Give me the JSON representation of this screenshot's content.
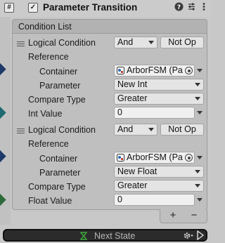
{
  "header": {
    "script_icon": "#",
    "enabled_check": "✓",
    "title": "Parameter Transition",
    "icons": [
      "help-icon",
      "preset-icon",
      "more-icon"
    ]
  },
  "list": {
    "title": "Condition List",
    "conditions": [
      {
        "logical_label": "Logical Condition",
        "logical_value": "And",
        "not_label": "Not Op",
        "reference_label": "Reference",
        "container_label": "Container",
        "container_value": "ArborFSM (Pa",
        "parameter_label": "Parameter",
        "parameter_value": "New Int",
        "compare_label": "Compare Type",
        "compare_value": "Greater",
        "value_label": "Int Value",
        "value": "0"
      },
      {
        "logical_label": "Logical Condition",
        "logical_value": "And",
        "not_label": "Not Op",
        "reference_label": "Reference",
        "container_label": "Container",
        "container_value": "ArborFSM (Pa",
        "parameter_label": "Parameter",
        "parameter_value": "New Float",
        "compare_label": "Compare Type",
        "compare_value": "Greater",
        "value_label": "Float Value",
        "value": "0"
      }
    ],
    "add_label": "+",
    "remove_label": "−"
  },
  "state_link": {
    "name": "Next State",
    "icon": "hourglass-icon",
    "settings_icon": "gear-icon",
    "arrow_icon": "link-arrow-icon"
  },
  "colors": {
    "state_green": "#3fa33f",
    "side_diamond_navy": "#1e3a6a",
    "side_diamond_teal": "#1d6a70",
    "side_diamond_green": "#2d6a3a"
  }
}
